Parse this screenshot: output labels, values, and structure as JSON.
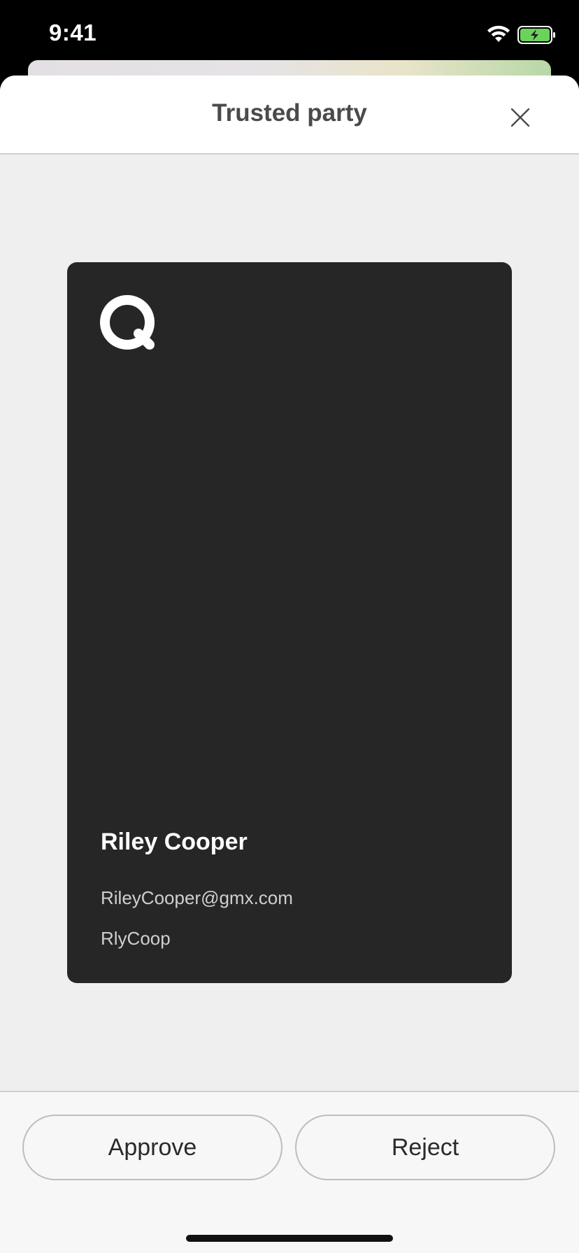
{
  "status_bar": {
    "time": "9:41"
  },
  "sheet": {
    "title": "Trusted party"
  },
  "card": {
    "logo_letter": "Q",
    "name": "Riley Cooper",
    "email": "RileyCooper@gmx.com",
    "username": "RlyCoop"
  },
  "actions": {
    "approve_label": "Approve",
    "reject_label": "Reject"
  },
  "colors": {
    "card_background": "#262626",
    "sheet_background": "#efefef",
    "header_background": "#ffffff",
    "title_text": "#4a4a4a",
    "battery_fill": "#6bd35c"
  },
  "icons": {
    "close": "close-icon",
    "wifi": "wifi-icon",
    "battery": "battery-charging-icon",
    "logo": "q-logo-icon"
  }
}
